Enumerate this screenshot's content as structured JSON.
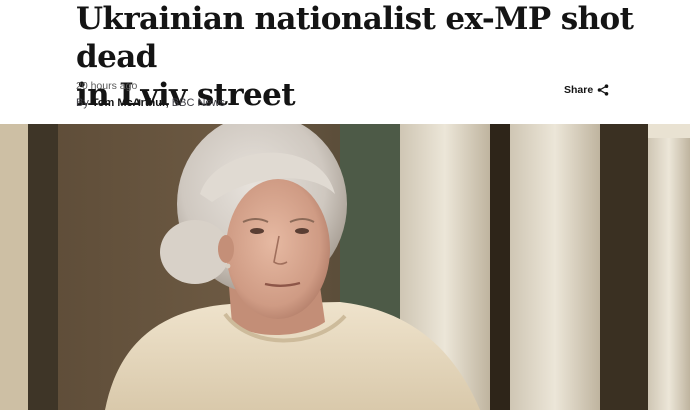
{
  "article": {
    "headline_line1": "Ukrainian nationalist ex-MP shot dead",
    "headline_line2": "in Lviv street",
    "timestamp": "20 hours ago",
    "byline_prefix": "By",
    "author": "Tom McArthur,",
    "outlet": "BBC News",
    "share_label": "Share"
  },
  "icons": {
    "share": "share-icon"
  },
  "colors": {
    "text": "#141414",
    "meta": "#5a5a5a"
  }
}
